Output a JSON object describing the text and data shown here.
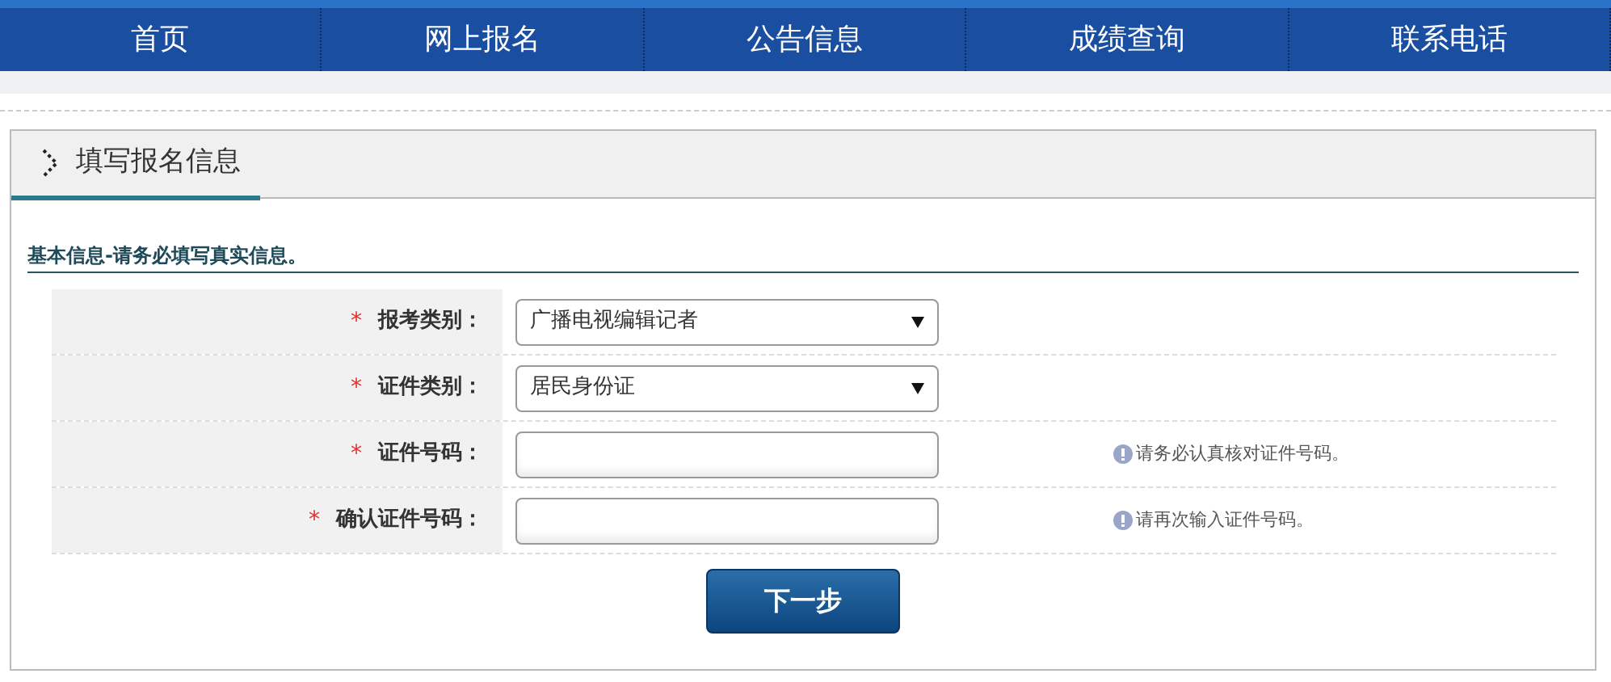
{
  "nav": [
    {
      "label": "首页"
    },
    {
      "label": "网上报名"
    },
    {
      "label": "公告信息"
    },
    {
      "label": "成绩查询"
    },
    {
      "label": "联系电话"
    }
  ],
  "panel": {
    "title": "填写报名信息"
  },
  "section": {
    "title": "基本信息-请务必填写真实信息。"
  },
  "fields": [
    {
      "kind": "select",
      "required_mark": "*",
      "label": "报考类别：",
      "value": "广播电视编辑记者"
    },
    {
      "kind": "select",
      "required_mark": "*",
      "label": "证件类别：",
      "value": "居民身份证"
    },
    {
      "kind": "input",
      "required_mark": "*",
      "label": "证件号码：",
      "hint": "请务必认真核对证件号码。"
    },
    {
      "kind": "input",
      "required_mark": "*",
      "label": "确认证件号码：",
      "hint": "请再次输入证件号码。"
    }
  ],
  "submit": {
    "label": "下一步"
  }
}
